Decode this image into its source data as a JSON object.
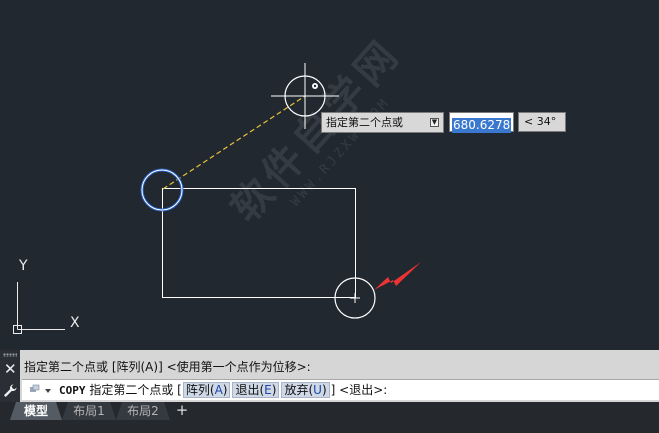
{
  "tooltip": {
    "prompt": "指定第二个点或",
    "dropdown_glyph": "▼",
    "distance_value": "680.6278",
    "angle_value": "< 34°"
  },
  "ucs": {
    "y_label": "Y",
    "x_label": "X"
  },
  "watermark": {
    "main": "软件自学网",
    "sub": "WWW.RJZXW.COM"
  },
  "command_line": {
    "history": "指定第二个点或 [阵列(A)] <使用第一个点作为位移>:",
    "close_glyph": "✕",
    "command_name": "COPY",
    "prompt": "指定第二个点或",
    "bracket_open": "[",
    "options": [
      {
        "label": "阵列",
        "key": "A"
      },
      {
        "label": "退出",
        "key": "E"
      },
      {
        "label": "放弃",
        "key": "U"
      }
    ],
    "bracket_close": "]",
    "default_text": "<退出>:"
  },
  "layout_tabs": {
    "tabs": [
      {
        "label": "模型",
        "active": true
      },
      {
        "label": "布局1",
        "active": false
      },
      {
        "label": "布局2",
        "active": false
      }
    ],
    "add_glyph": "+"
  },
  "colors": {
    "background": "#212830",
    "geometry": "#ffffff",
    "rubber_band": "#e8c23a",
    "snap_marker": "#4a90ff",
    "arrow": "#ee3333"
  }
}
